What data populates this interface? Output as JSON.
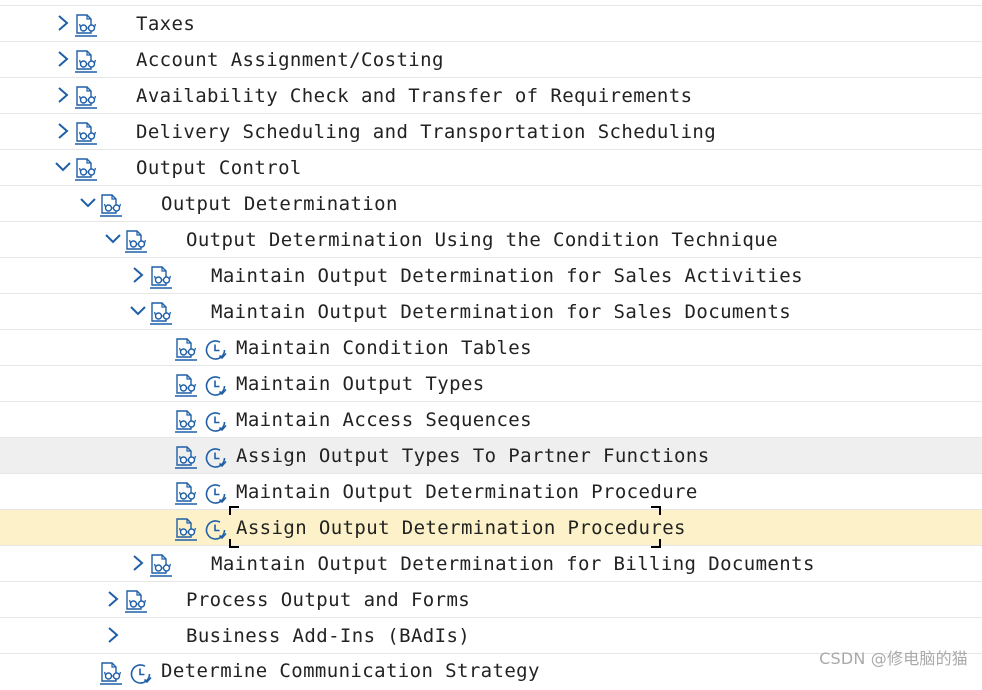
{
  "tree": {
    "rows": [
      {
        "label": "Taxes",
        "expanded": false,
        "has_chevron": true,
        "has_doc": true,
        "has_clock": false
      },
      {
        "label": "Account Assignment/Costing",
        "expanded": false,
        "has_chevron": true,
        "has_doc": true,
        "has_clock": false
      },
      {
        "label": "Availability Check and Transfer of Requirements",
        "expanded": false,
        "has_chevron": true,
        "has_doc": true,
        "has_clock": false
      },
      {
        "label": "Delivery Scheduling and Transportation Scheduling",
        "expanded": false,
        "has_chevron": true,
        "has_doc": true,
        "has_clock": false
      },
      {
        "label": "Output Control",
        "expanded": true,
        "has_chevron": true,
        "has_doc": true,
        "has_clock": false
      },
      {
        "label": "Output Determination",
        "expanded": true,
        "has_chevron": true,
        "has_doc": true,
        "has_clock": false
      },
      {
        "label": "Output Determination Using the Condition Technique",
        "expanded": true,
        "has_chevron": true,
        "has_doc": true,
        "has_clock": false
      },
      {
        "label": "Maintain Output Determination for Sales Activities",
        "expanded": false,
        "has_chevron": true,
        "has_doc": true,
        "has_clock": false
      },
      {
        "label": "Maintain Output Determination for Sales Documents",
        "expanded": true,
        "has_chevron": true,
        "has_doc": true,
        "has_clock": false
      },
      {
        "label": "Maintain Condition Tables",
        "has_chevron": false,
        "has_doc": true,
        "has_clock": true
      },
      {
        "label": "Maintain Output Types",
        "has_chevron": false,
        "has_doc": true,
        "has_clock": true
      },
      {
        "label": "Maintain Access Sequences",
        "has_chevron": false,
        "has_doc": true,
        "has_clock": true
      },
      {
        "label": "Assign Output Types To Partner Functions",
        "has_chevron": false,
        "has_doc": true,
        "has_clock": true,
        "state": "hover"
      },
      {
        "label": "Maintain Output Determination Procedure",
        "has_chevron": false,
        "has_doc": true,
        "has_clock": true
      },
      {
        "label": "Assign Output Determination Procedures",
        "has_chevron": false,
        "has_doc": true,
        "has_clock": true,
        "state": "selected"
      },
      {
        "label": "Maintain Output Determination for Billing Documents",
        "expanded": false,
        "has_chevron": true,
        "has_doc": true,
        "has_clock": false
      },
      {
        "label": "Process Output and Forms",
        "expanded": false,
        "has_chevron": true,
        "has_doc": true,
        "has_clock": false
      },
      {
        "label": "Business Add-Ins (BAdIs)",
        "expanded": false,
        "has_chevron": true,
        "has_doc": false,
        "has_clock": false
      },
      {
        "label": "Determine Communication Strategy",
        "has_chevron": false,
        "has_doc": true,
        "has_clock": true
      }
    ]
  },
  "colors": {
    "icon_blue": "#1f5fa8",
    "hover_row": "#efefef",
    "selected_row": "#fcf1c8",
    "separator": "#e6e6e6"
  },
  "icons": {
    "chevron_collapsed": "chevron-right-icon",
    "chevron_expanded": "chevron-down-icon",
    "document": "documentation-glasses-icon",
    "execute": "clock-execute-icon"
  },
  "watermark": "CSDN @修电脑的猫"
}
